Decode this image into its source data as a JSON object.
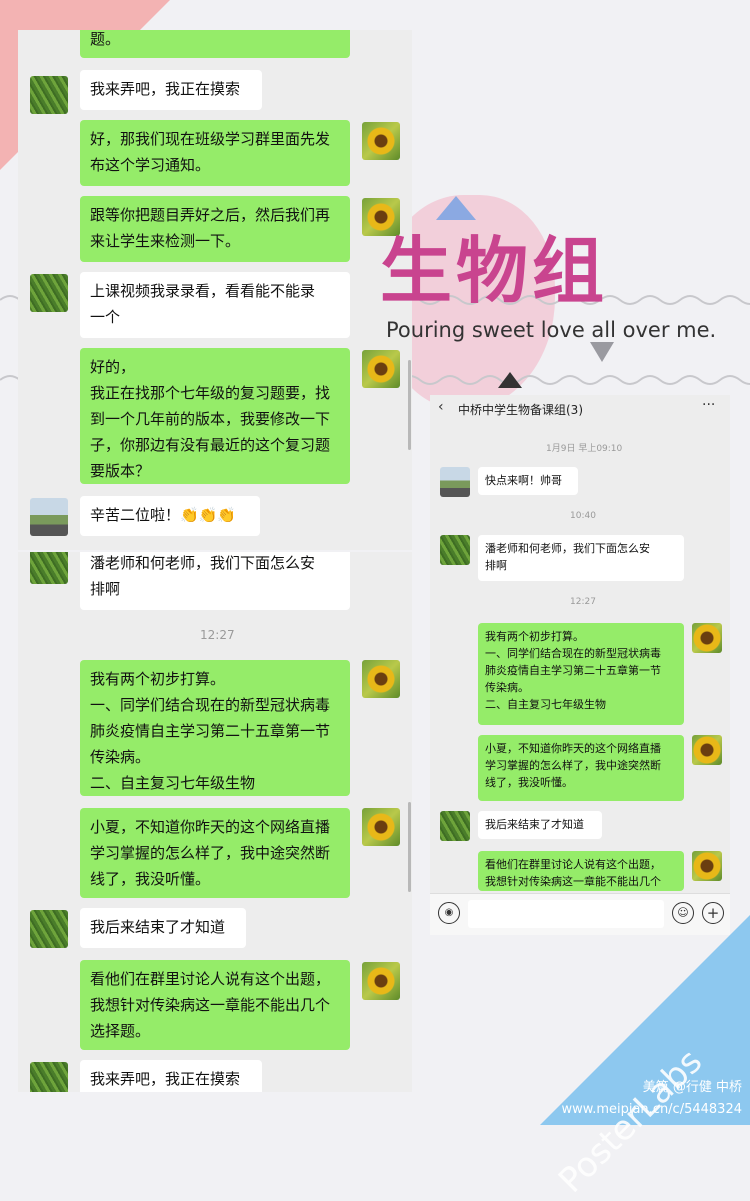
{
  "decor": {
    "title": "生物组",
    "subtitle": "Pouring sweet love all over me.",
    "brand": "PosterLabs",
    "footer_author": "美篇 @行健 中桥",
    "footer_url": "www.meipian.cn/c/5448324",
    "colors": {
      "pink": "#f3b3b3",
      "blue": "#8dc8ef",
      "magenta": "#c9448f",
      "green_bubble": "#95ec69"
    }
  },
  "left_top": {
    "messages": [
      {
        "side": "right",
        "text": "题。"
      },
      {
        "side": "left",
        "text": "我来弄吧，我正在摸索"
      },
      {
        "side": "right",
        "text": "好，那我们现在班级学习群里面先发\n布这个学习通知。"
      },
      {
        "side": "right",
        "text": "跟等你把题目弄好之后，然后我们再\n来让学生来检测一下。"
      },
      {
        "side": "left",
        "text": "上课视频我录录看，看看能不能录\n一个"
      },
      {
        "side": "right",
        "text": "好的，\n我正在找那个七年级的复习题要，找\n到一个几年前的版本，我要修改一下\n子，你那边有没有最近的这个复习题\n要版本？"
      },
      {
        "side": "left",
        "text": "辛苦二位啦！👏👏👏"
      }
    ]
  },
  "left_bottom": {
    "time": "12:27",
    "messages": [
      {
        "side": "left",
        "text": "潘老师和何老师，我们下面怎么安\n排啊"
      },
      {
        "side": "right",
        "text": "我有两个初步打算。\n一、同学们结合现在的新型冠状病毒\n肺炎疫情自主学习第二十五章第一节\n传染病。\n二、自主复习七年级生物"
      },
      {
        "side": "right",
        "text": "小夏，不知道你昨天的这个网络直播\n学习掌握的怎么样了，我中途突然断\n线了，我没听懂。"
      },
      {
        "side": "left",
        "text": "我后来结束了才知道"
      },
      {
        "side": "right",
        "text": "看他们在群里讨论人说有这个出题，\n我想针对传染病这一章能不能出几个\n选择题。"
      },
      {
        "side": "left",
        "text": "我来弄吧，我正在摸索"
      }
    ]
  },
  "right_panel": {
    "header_title": "中桥中学生物备课组(3)",
    "back_icon": "back-arrow-icon",
    "more_icon": "more-dots-icon",
    "time1": "1月9日 早上09:10",
    "time2": "10:40",
    "time3": "12:27",
    "messages": [
      {
        "side": "left",
        "text": "快点来啊！帅哥"
      },
      {
        "side": "left",
        "text": "潘老师和何老师，我们下面怎么安\n排啊"
      },
      {
        "side": "right",
        "text": "我有两个初步打算。\n一、同学们结合现在的新型冠状病毒\n肺炎疫情自主学习第二十五章第一节\n传染病。\n二、自主复习七年级生物"
      },
      {
        "side": "right",
        "text": "小夏，不知道你昨天的这个网络直播\n学习掌握的怎么样了，我中途突然断\n线了，我没听懂。"
      },
      {
        "side": "left",
        "text": "我后来结束了才知道"
      },
      {
        "side": "right",
        "text": "看他们在群里讨论人说有这个出题，\n我想针对传染病这一章能不能出几个"
      }
    ],
    "input_placeholder": ""
  }
}
